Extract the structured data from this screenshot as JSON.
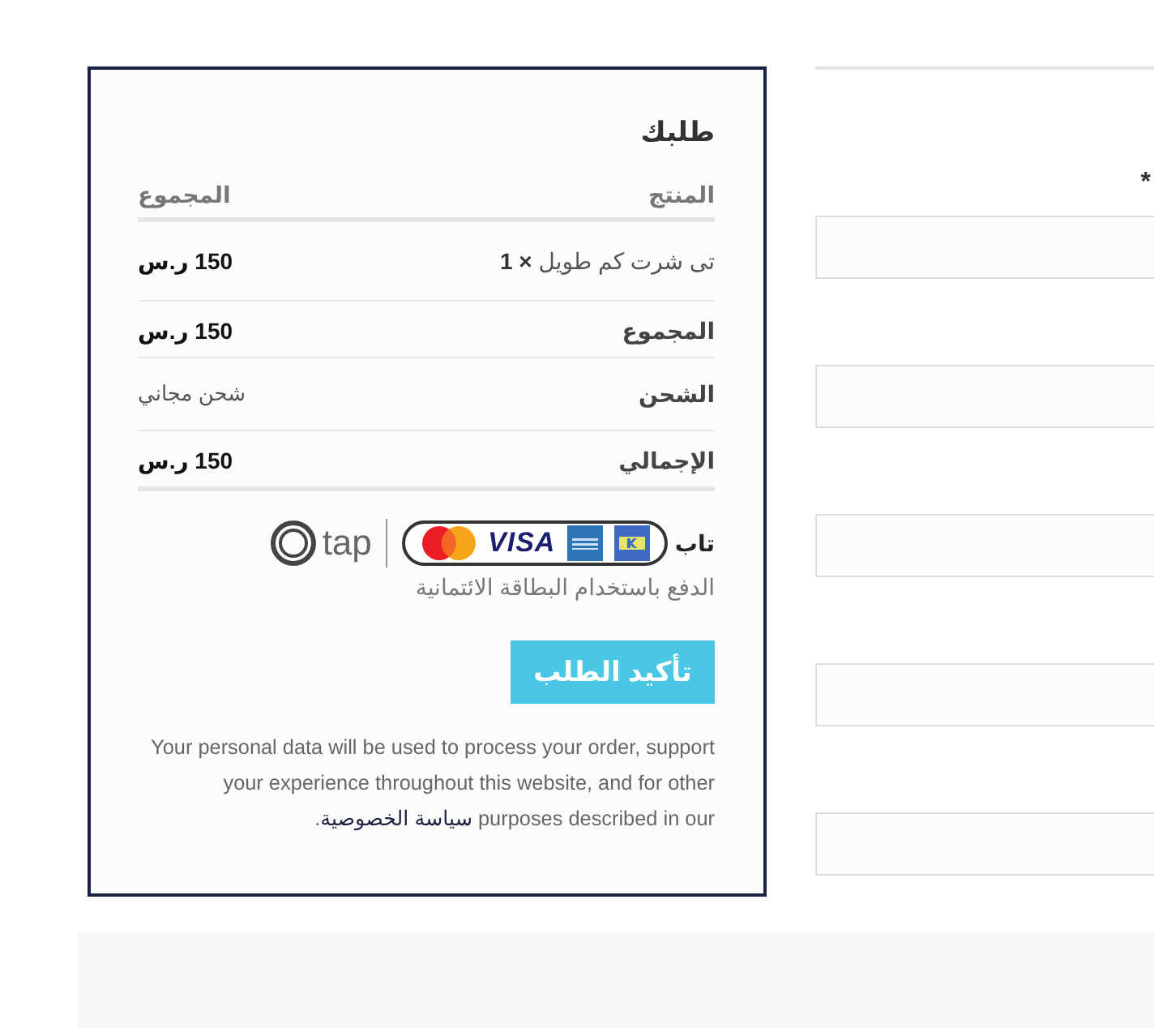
{
  "order_summary": {
    "title": "طلبك",
    "columns": [
      "المنتج",
      "المجموع"
    ],
    "items": [
      {
        "product": "تى شرت كم طويل **× 1**",
        "total": "150 ر.س"
      }
    ],
    "totals": [
      {
        "label": "المجموع",
        "value": "150 ر.س",
        "kind": "amount"
      },
      {
        "label": "الشحن",
        "value": "شحن مجاني",
        "kind": "note"
      },
      {
        "label": "الإجمالي",
        "value": "150 ر.س",
        "kind": "amount"
      }
    ]
  },
  "payment_method": {
    "label": "تاب",
    "card_logos": [
      {
        "kind": "knet"
      },
      {
        "kind": "amex"
      },
      {
        "kind": "visa",
        "text": "VISA"
      },
      {
        "kind": "mastercard"
      }
    ],
    "provider_logo": "tap",
    "description": "الدفع باستخدام البطاقة الائتمانية"
  },
  "place_order_button": "تأكيد الطلب",
  "privacy_notice": {
    "text": "Your personal data will be used to process your order, support your experience throughout this website, and for other purposes described in our",
    "link": "سياسة الخصوصية",
    "end": "."
  },
  "billing_form": {
    "required_mark": "*",
    "fields": [
      {
        "kind": "text"
      },
      {
        "kind": "text"
      },
      {
        "kind": "text"
      },
      {
        "kind": "text"
      },
      {
        "kind": "text"
      }
    ]
  }
}
